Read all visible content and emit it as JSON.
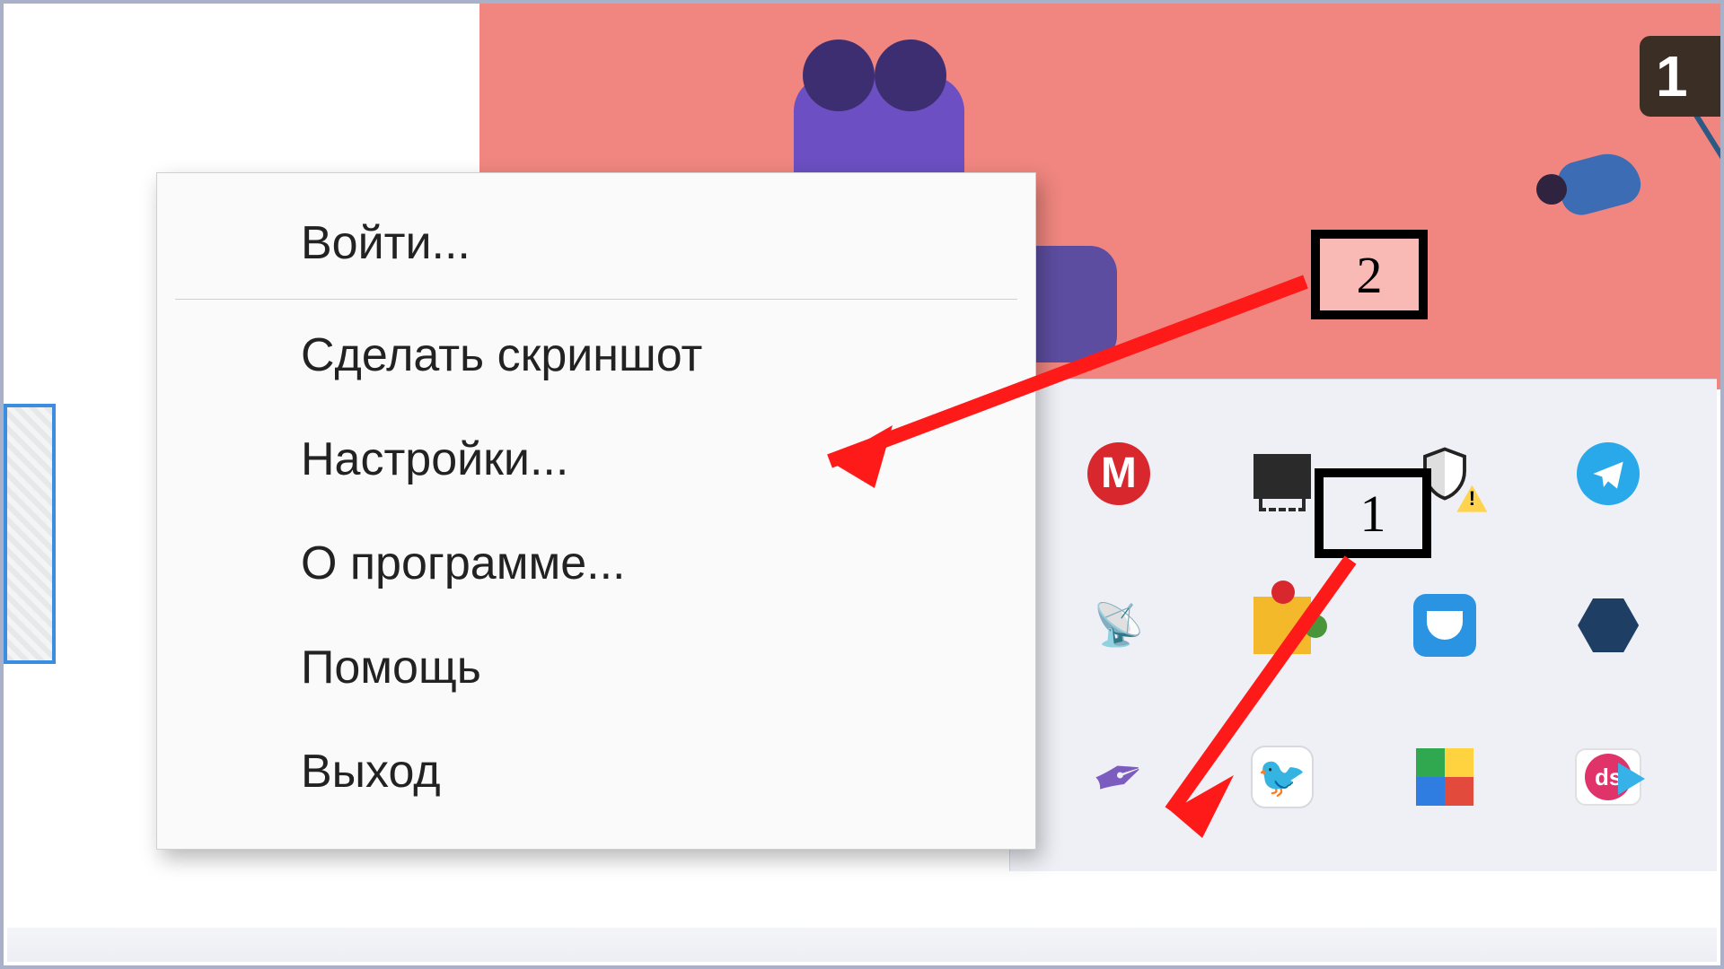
{
  "context_menu": {
    "login": "Войти...",
    "screenshot": "Сделать скриншот",
    "settings": "Настройки...",
    "about": "О программе...",
    "help": "Помощь",
    "exit": "Выход"
  },
  "annotations": {
    "step1": "1",
    "step2": "2"
  },
  "date_badge": "1",
  "tray": {
    "mega": "M",
    "printer": "printer-icon",
    "defender": "defender-shield-icon",
    "defender_warning": "!",
    "telegram": "telegram-icon",
    "antenna": "dish-icon",
    "puzzle": "puzzle-icon",
    "pocket": "pocket-icon",
    "hexagon": "hex-app-icon",
    "feather": "feather-icon",
    "colibri": "colibri-icon",
    "squares": "microsoft-tiles-icon",
    "ds": "ds",
    "ds_label": "ds"
  }
}
